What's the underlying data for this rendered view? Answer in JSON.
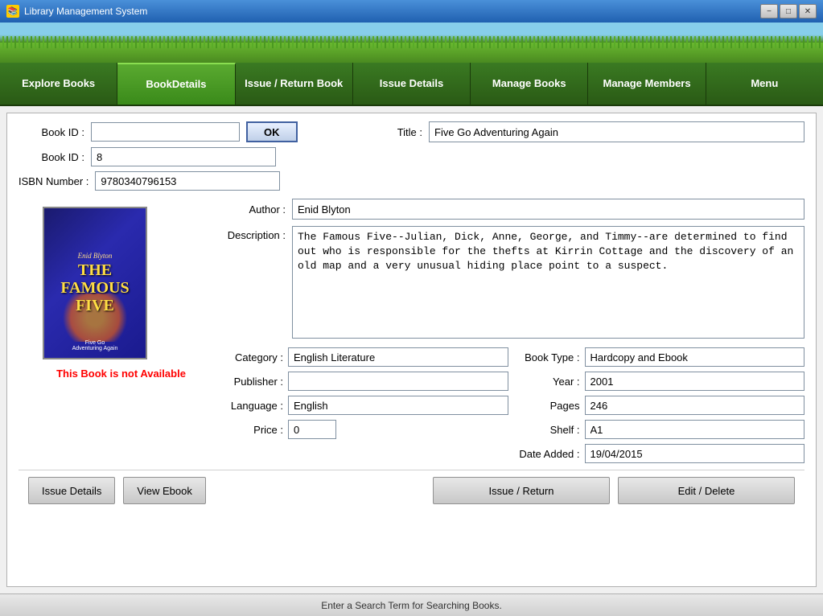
{
  "titleBar": {
    "title": "Library Management System",
    "minBtn": "−",
    "maxBtn": "□",
    "closeBtn": "✕"
  },
  "nav": {
    "items": [
      {
        "id": "explore-books",
        "label": "Explore Books",
        "active": false
      },
      {
        "id": "book-details",
        "label": "BookDetails",
        "active": true
      },
      {
        "id": "issue-return",
        "label": "Issue / Return Book",
        "active": false
      },
      {
        "id": "issue-details",
        "label": "Issue Details",
        "active": false
      },
      {
        "id": "manage-books",
        "label": "Manage Books",
        "active": false
      },
      {
        "id": "manage-members",
        "label": "Manage Members",
        "active": false
      },
      {
        "id": "menu",
        "label": "Menu",
        "active": false
      }
    ]
  },
  "form": {
    "bookIdLabel1": "Book ID :",
    "bookIdLabel2": "Book ID :",
    "isbnLabel": "ISBN Number :",
    "okBtn": "OK",
    "bookIdValue": "8",
    "isbnValue": "9780340796153",
    "bookIdInput": ""
  },
  "book": {
    "titleLabel": "Title :",
    "title": "Five Go Adventuring Again",
    "authorLabel": "Author :",
    "author": "Enid Blyton",
    "descriptionLabel": "Description :",
    "description": "The Famous Five--Julian, Dick, Anne, George, and Timmy--are determined to find out who is responsible for the thefts at Kirrin Cottage and the discovery of an old map and a very unusual hiding place point to a suspect.",
    "categoryLabel": "Category :",
    "category": "English Literature",
    "publisherLabel": "Publisher :",
    "publisher": "",
    "languageLabel": "Language :",
    "language": "English",
    "priceLabel": "Price :",
    "price": "0",
    "bookTypeLabel": "Book Type :",
    "bookType": "Hardcopy and Ebook",
    "yearLabel": "Year :",
    "year": "2001",
    "pagesLabel": "Pages",
    "pages": "246",
    "shelfLabel": "Shelf :",
    "shelf": "A1",
    "dateAddedLabel": "Date Added :",
    "dateAdded": "19/04/2015",
    "coverTitle": "THE FAMOUS FIVE",
    "coverSubtitle": "Five Go Adventuring Again",
    "coverAuthor": "Enid Blyton",
    "availability": "This Book is not Available"
  },
  "buttons": {
    "issueDetails": "Issue Details",
    "viewEbook": "View Ebook",
    "issueReturn": "Issue / Return",
    "editDelete": "Edit / Delete"
  },
  "statusBar": {
    "text": "Enter a Search Term for Searching Books."
  }
}
